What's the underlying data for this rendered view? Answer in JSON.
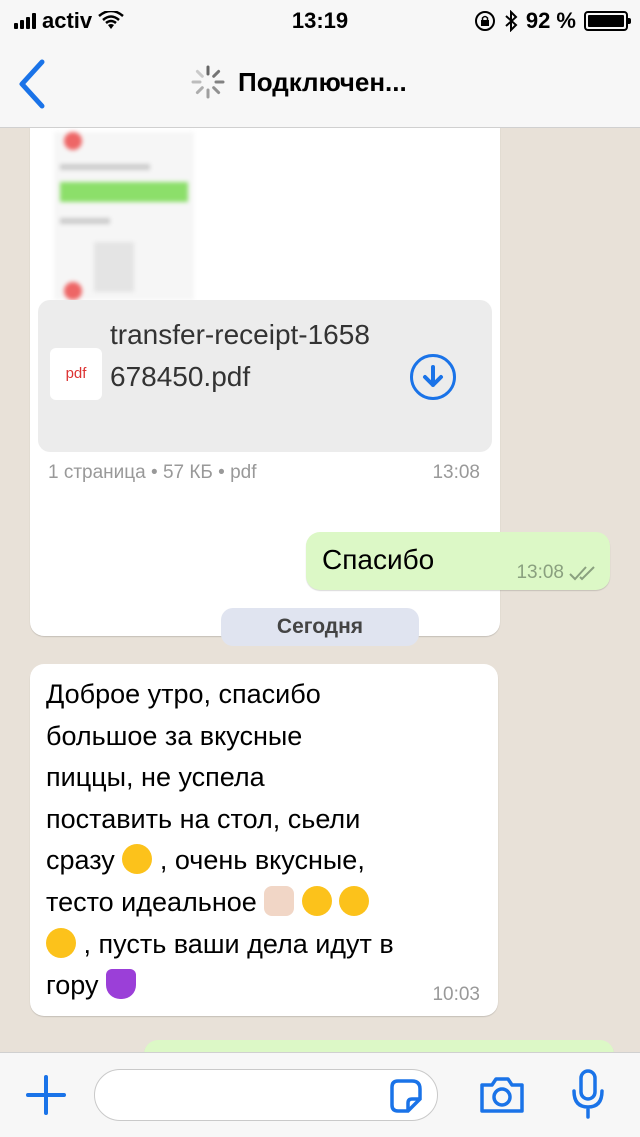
{
  "status_bar": {
    "carrier": "activ",
    "time": "13:19",
    "battery": "92 %"
  },
  "header": {
    "title": "Подключен..."
  },
  "messages": [
    {
      "type": "file",
      "file_type_label": "pdf",
      "file_name": "transfer-receipt-1658678450.pdf",
      "meta": "1 страница • 57 КБ • pdf",
      "time": "13:08"
    },
    {
      "type": "outgoing",
      "text": "Спасибо",
      "time": "13:08"
    },
    {
      "type": "date",
      "text": "Сегодня"
    },
    {
      "type": "incoming",
      "text_lines": [
        "Доброе утро, спасибо",
        "большое за вкусные",
        "пиццы, не успела",
        "поставить на стол, сьели",
        "сразу",
        ", очень вкусные,",
        "тесто идеальное",
        ", пусть ваши дела идут в",
        "гору"
      ],
      "time": "10:03"
    }
  ],
  "input_bar": {
    "placeholder": ""
  },
  "colors": {
    "accent": "#1a73e8",
    "outgoing_bubble": "#dcf8c6",
    "incoming_bubble": "#ffffff",
    "chat_background": "#e8e1d8"
  }
}
